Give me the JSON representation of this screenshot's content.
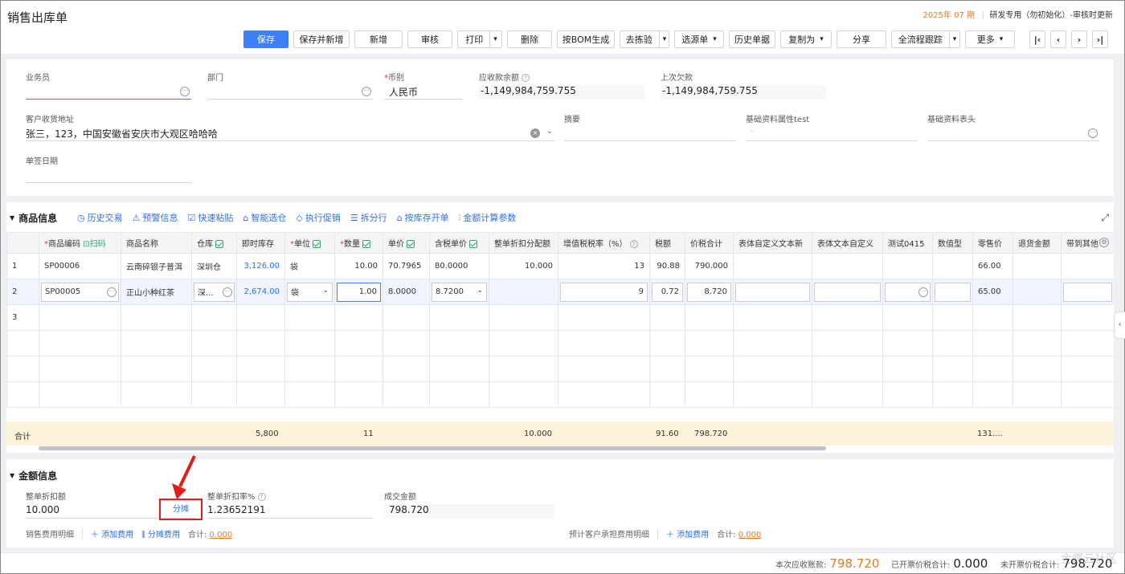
{
  "header": {
    "title": "销售出库单",
    "period": "2025年 07 期",
    "org": "研发专用（勿初始化）-审核时更新",
    "buttons": {
      "save": "保存",
      "save_new": "保存并新增",
      "add": "新增",
      "audit": "审核",
      "print": "打印",
      "delete": "删除",
      "bom": "按BOM生成",
      "inspect": "去拣验",
      "select_source": "选源单",
      "history": "历史单据",
      "copy_as": "复制为",
      "share": "分享",
      "trace": "全流程跟踪",
      "more": "更多"
    }
  },
  "form": {
    "salesman_label": "业务员",
    "dept_label": "部门",
    "currency_label": "币别",
    "currency_value": "人民币",
    "receivable_label": "应收款余额",
    "receivable_value": "-1,149,984,759.755",
    "last_debt_label": "上次欠款",
    "last_debt_value": "-1,149,984,759.755",
    "address_label": "客户收货地址",
    "address_value": "张三，123，中国安徽省安庆市大观区哈哈哈",
    "summary_label": "摘要",
    "basic_test_label": "基础资料属性test",
    "basic_test_value": "-",
    "basic_header_label": "基础资料表头",
    "sign_date_label": "单签日期"
  },
  "goods": {
    "section_title": "商品信息",
    "links": [
      "历史交易",
      "预警信息",
      "快速粘贴",
      "智能选仓",
      "执行促销",
      "拆分行",
      "按库存开单",
      "金额计算参数"
    ],
    "columns": {
      "code": "商品编码",
      "scan": "扫码",
      "name": "商品名称",
      "warehouse": "仓库",
      "stock": "即时库存",
      "unit": "单位",
      "qty": "数量",
      "price": "单价",
      "tax_price": "含税单价",
      "discount_alloc": "整单折扣分配额",
      "vat_rate": "增值税税率（%）",
      "tax": "税额",
      "total": "价税合计",
      "custom_text_new": "表体自定义文本新",
      "custom_text": "表体文本自定义",
      "test0415": "测试0415",
      "numtype": "数值型",
      "retail": "零售价",
      "return_amt": "退货金额",
      "bring_other": "带到其他"
    },
    "rows": [
      {
        "idx": "1",
        "code": "SP00006",
        "name": "云南碎银子普洱",
        "warehouse": "深圳仓",
        "stock": "3,126.00",
        "unit": "袋",
        "qty": "10.00",
        "price": "70.7965",
        "tax_price": "80.0000",
        "discount_alloc": "10.000",
        "vat_rate": "13",
        "tax": "90.88",
        "total": "790.000",
        "retail": "66.00"
      },
      {
        "idx": "2",
        "code": "SP00005",
        "name": "正山小种红茶",
        "warehouse": "深...",
        "stock": "2,674.00",
        "unit": "袋",
        "qty": "1.00",
        "price": "8.0000",
        "tax_price": "8.7200",
        "discount_alloc": "",
        "vat_rate": "9",
        "tax": "0.72",
        "total": "8.720",
        "retail": "65.00"
      },
      {
        "idx": "3"
      }
    ],
    "totals": {
      "label": "合计",
      "stock": "5,800",
      "qty": "11",
      "discount_alloc": "10.000",
      "tax": "91.60",
      "total": "798.720",
      "retail": "131...."
    }
  },
  "amount": {
    "section_title": "金额信息",
    "discount_label": "整单折扣额",
    "discount_value": "10.000",
    "alloc_button": "分摊",
    "discount_rate_label": "整单折扣率%",
    "discount_rate_value": "1.23652191",
    "deal_amount_label": "成交金额",
    "deal_amount_value": "798.720",
    "sales_fee_label": "销售费用明细",
    "add_fee": "添加费用",
    "alloc_fee": "分摊费用",
    "sum_label": "合计:",
    "sum_value": "0.000",
    "cust_fee_label": "预计客户承担费用明细",
    "add_fee2": "添加费用",
    "sum_label2": "合计:",
    "sum_value2": "0.000"
  },
  "footer": {
    "receivable_label": "本次应收账款:",
    "receivable_value": "798.720",
    "invoiced_label": "已开票价税合计:",
    "invoiced_value": "0.000",
    "uninvoiced_label": "未开票价税合计:",
    "uninvoiced_value": "798.720",
    "watermark": "金蝶云社区"
  },
  "colors": {
    "primary": "#3d7ff5",
    "orange": "#e07b2a",
    "highlight": "#e21b1b",
    "total_bg": "#fdf3db"
  }
}
